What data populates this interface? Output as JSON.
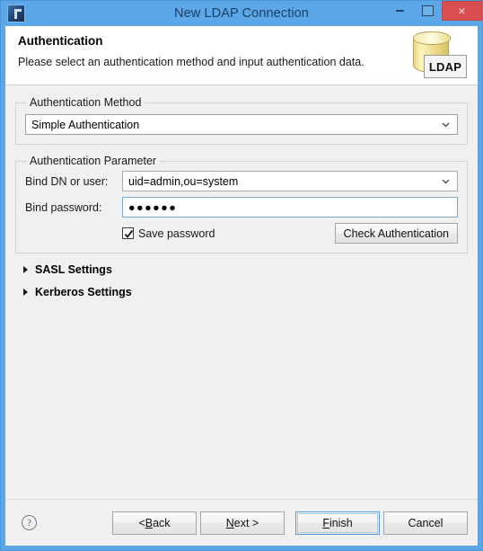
{
  "window": {
    "title": "New LDAP Connection",
    "app_icon": "app-icon",
    "controls": {
      "minimize": "minimize-button",
      "maximize": "maximize-button",
      "close_label": "×"
    }
  },
  "header": {
    "title": "Authentication",
    "description": "Please select an authentication method and input authentication data.",
    "graphic_label": "LDAP"
  },
  "auth_method": {
    "group_label": "Authentication Method",
    "selected": "Simple Authentication"
  },
  "auth_parameter": {
    "group_label": "Authentication Parameter",
    "bind_dn": {
      "label": "Bind DN or user:",
      "value": "uid=admin,ou=system"
    },
    "bind_password": {
      "label": "Bind password:",
      "value": "●●●●●●"
    },
    "save_password": {
      "label": "Save password",
      "checked": true
    },
    "check_auth_label": "Check Authentication"
  },
  "expanders": [
    {
      "label": "SASL Settings",
      "expanded": false
    },
    {
      "label": "Kerberos Settings",
      "expanded": false
    }
  ],
  "footer": {
    "help_label": "?",
    "buttons": {
      "back": {
        "pre": "< ",
        "mnemonic": "B",
        "post": "ack"
      },
      "next": {
        "pre": "",
        "mnemonic": "N",
        "post": "ext >"
      },
      "finish": {
        "pre": "",
        "mnemonic": "F",
        "post": "inish"
      },
      "cancel": {
        "pre": "",
        "mnemonic": "",
        "post": "Cancel"
      }
    }
  },
  "colors": {
    "titlebar": "#5ba7e8",
    "close_button": "#d94f4f",
    "body_bg": "#f0f0f0",
    "focus_border": "#7aa9d2"
  }
}
